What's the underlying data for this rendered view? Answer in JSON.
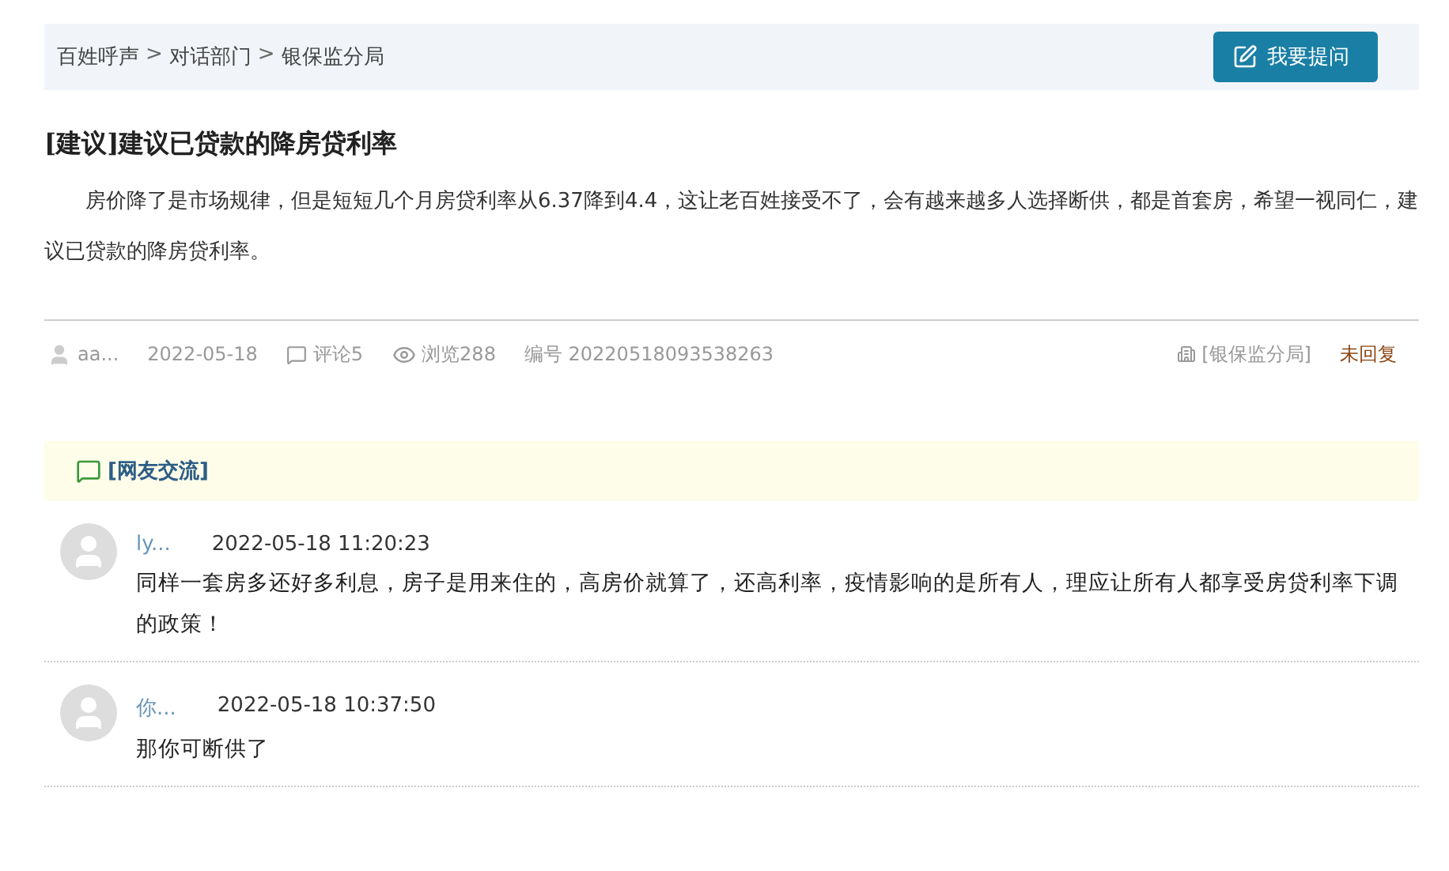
{
  "breadcrumb": {
    "items": [
      "百姓呼声",
      "对话部门",
      "银保监分局"
    ],
    "separator": ">"
  },
  "ask_button": {
    "label": "我要提问"
  },
  "post": {
    "tag": "[建议]",
    "title": "建议已贷款的降房贷利率",
    "body": "房价降了是市场规律，但是短短几个月房贷利率从6.37降到4.4，这让老百姓接受不了，会有越来越多人选择断供，都是首套房，希望一视同仁，建议已贷款的降房贷利率。"
  },
  "meta": {
    "author": "aa...",
    "date": "2022-05-18",
    "comments": "评论5",
    "views": "浏览288",
    "number": "编号 20220518093538263",
    "department": "[银保监分局]",
    "status": "未回复"
  },
  "section": {
    "title": "[网友交流]"
  },
  "replies": [
    {
      "user": "ly...",
      "time": "2022-05-18 11:20:23",
      "text": "同样一套房多还好多利息，房子是用来住的，高房价就算了，还高利率，疫情影响的是所有人，理应让所有人都享受房贷利率下调的政策！"
    },
    {
      "user": "你...",
      "time": "2022-05-18 10:37:50",
      "text": "那你可断供了"
    }
  ]
}
